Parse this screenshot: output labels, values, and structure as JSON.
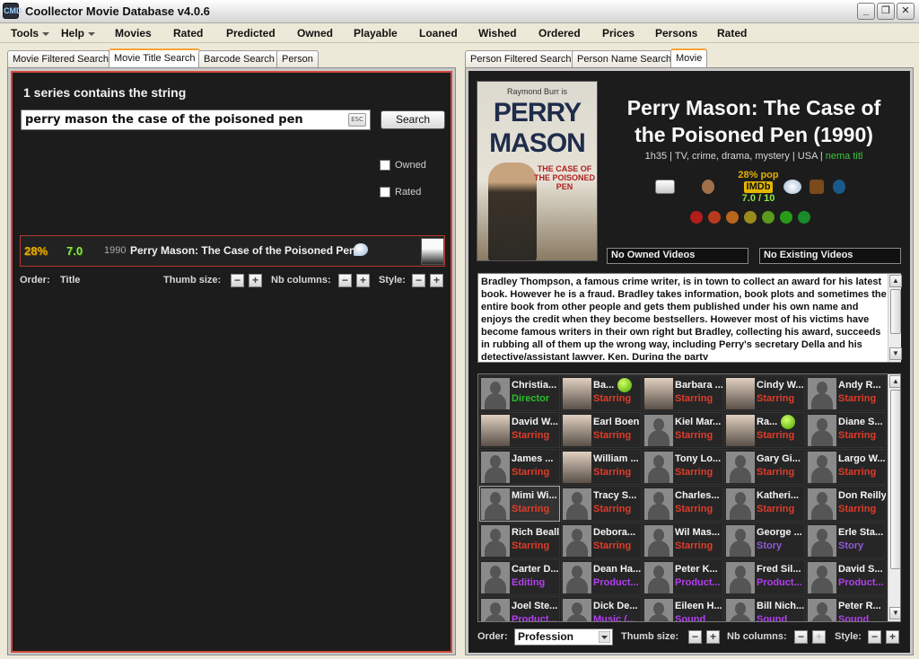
{
  "window": {
    "title": "Coollector Movie Database  v4.0.6",
    "icon_text": "CMD"
  },
  "menu": [
    {
      "label": "Tools",
      "dropdown": true
    },
    {
      "label": "Help",
      "dropdown": true
    },
    {
      "label": "Movies"
    },
    {
      "label": "Rated"
    },
    {
      "label": "Predicted"
    },
    {
      "label": "Owned"
    },
    {
      "label": "Playable"
    },
    {
      "label": "Loaned"
    },
    {
      "label": "Wished"
    },
    {
      "label": "Ordered"
    },
    {
      "label": "Prices"
    },
    {
      "label": "Persons"
    },
    {
      "label": "Rated"
    }
  ],
  "left_tabs": [
    "Movie Filtered Search",
    "Movie Title Search",
    "Barcode Search",
    "Person"
  ],
  "left_active_tab": "Movie Title Search",
  "right_tabs": [
    "Person Filtered Search",
    "Person Name Search",
    "Movie"
  ],
  "right_active_tab": "Movie",
  "search": {
    "heading": "1 series contains the string",
    "query": "perry mason the case of the poisoned pen",
    "esc_label": "ESC",
    "button_label": "Search",
    "filters": [
      {
        "label": "Owned",
        "checked": false
      },
      {
        "label": "Rated",
        "checked": false
      }
    ]
  },
  "result": {
    "popularity": "28%",
    "rating": "7.0",
    "year": "1990",
    "title": "Perry Mason: The Case of the Poisoned Pen"
  },
  "left_controls": {
    "order_label": "Order:",
    "order_value": "Title",
    "thumb_label": "Thumb size:",
    "columns_label": "Nb columns:",
    "style_label": "Style:"
  },
  "movie": {
    "poster": {
      "brand": "Raymond Burr is",
      "title_line1": "PERRY",
      "title_line2": "MASON",
      "subtitle": "THE CASE OF THE POISONED PEN"
    },
    "title": "Perry Mason: The Case of the Poisoned Pen (1990)",
    "meta": "1h35 | TV, crime, drama, mystery | USA | ",
    "meta_link": "nema titl",
    "popularity": "28% pop",
    "imdb_label": "IMDb",
    "imdb_rating": "7.0 / 10",
    "owned_videos": "No Owned Videos",
    "existing_videos": "No Existing Videos",
    "plot": "Bradley Thompson, a famous crime writer, is in town to collect an award for his latest book. However he is a fraud. Bradley takes information, book plots and sometimes the entire book from other people and gets them published under his own name and enjoys the credit when they become bestsellers. However most of his victims have become famous writers in their own right but Bradley, collecting his award, succeeds in rubbing all of them up the wrong way, including Perry's secretary Della and his detective/assistant lawyer, Ken. During the party"
  },
  "colors": {
    "director": "#2bbf2b",
    "starring": "#e03c2a",
    "story": "#8e5ad8",
    "crew": "#b33ff0",
    "accent_tab": "#f7a43a",
    "panel_border": "#d24a3a"
  },
  "people": [
    {
      "name": "Christia...",
      "role": "Director",
      "type": "director",
      "photo": false
    },
    {
      "name": "Ba...",
      "role": "Starring",
      "type": "starring",
      "photo": true,
      "emoji": true
    },
    {
      "name": "Barbara ...",
      "role": "Starring",
      "type": "starring",
      "photo": true
    },
    {
      "name": "Cindy W...",
      "role": "Starring",
      "type": "starring",
      "photo": true
    },
    {
      "name": "Andy R...",
      "role": "Starring",
      "type": "starring",
      "photo": false
    },
    {
      "name": "David W...",
      "role": "Starring",
      "type": "starring",
      "photo": true
    },
    {
      "name": "Earl Boen",
      "role": "Starring",
      "type": "starring",
      "photo": true
    },
    {
      "name": "Kiel Mar...",
      "role": "Starring",
      "type": "starring",
      "photo": false
    },
    {
      "name": "Ra...",
      "role": "Starring",
      "type": "starring",
      "photo": true,
      "emoji": true
    },
    {
      "name": "Diane S...",
      "role": "Starring",
      "type": "starring",
      "photo": false
    },
    {
      "name": "James ...",
      "role": "Starring",
      "type": "starring",
      "photo": false
    },
    {
      "name": "William ...",
      "role": "Starring",
      "type": "starring",
      "photo": true
    },
    {
      "name": "Tony Lo...",
      "role": "Starring",
      "type": "starring",
      "photo": false
    },
    {
      "name": "Gary Gi...",
      "role": "Starring",
      "type": "starring",
      "photo": false
    },
    {
      "name": "Largo W...",
      "role": "Starring",
      "type": "starring",
      "photo": false
    },
    {
      "name": "Mimi Wi...",
      "role": "Starring",
      "type": "starring",
      "photo": false,
      "selected": true
    },
    {
      "name": "Tracy S...",
      "role": "Starring",
      "type": "starring",
      "photo": false
    },
    {
      "name": "Charles...",
      "role": "Starring",
      "type": "starring",
      "photo": false
    },
    {
      "name": "Katheri...",
      "role": "Starring",
      "type": "starring",
      "photo": false
    },
    {
      "name": "Don Reilly",
      "role": "Starring",
      "type": "starring",
      "photo": false
    },
    {
      "name": "Rich Beall",
      "role": "Starring",
      "type": "starring",
      "photo": false
    },
    {
      "name": "Debora...",
      "role": "Starring",
      "type": "starring",
      "photo": false
    },
    {
      "name": "Wil Mas...",
      "role": "Starring",
      "type": "starring",
      "photo": false
    },
    {
      "name": "George ...",
      "role": "Story",
      "type": "story",
      "photo": false
    },
    {
      "name": "Erle Sta...",
      "role": "Story",
      "type": "story",
      "photo": false
    },
    {
      "name": "Carter D...",
      "role": "Editing",
      "type": "crew",
      "photo": false
    },
    {
      "name": "Dean Ha...",
      "role": "Product...",
      "type": "crew",
      "photo": false
    },
    {
      "name": "Peter K...",
      "role": "Product...",
      "type": "crew",
      "photo": false
    },
    {
      "name": "Fred Sil...",
      "role": "Product...",
      "type": "crew",
      "photo": false
    },
    {
      "name": "David S...",
      "role": "Product...",
      "type": "crew",
      "photo": false
    },
    {
      "name": "Joel Ste...",
      "role": "Product...",
      "type": "crew",
      "photo": false
    },
    {
      "name": "Dick De...",
      "role": "Music (...",
      "type": "crew",
      "photo": false
    },
    {
      "name": "Eileen H...",
      "role": "Sound",
      "type": "crew",
      "photo": false
    },
    {
      "name": "Bill Nich...",
      "role": "Sound",
      "type": "crew",
      "photo": false
    },
    {
      "name": "Peter R...",
      "role": "Sound",
      "type": "crew",
      "photo": false
    }
  ],
  "right_controls": {
    "order_label": "Order:",
    "order_value": "Profession",
    "thumb_label": "Thumb size:",
    "columns_label": "Nb columns:",
    "style_label": "Style:"
  }
}
